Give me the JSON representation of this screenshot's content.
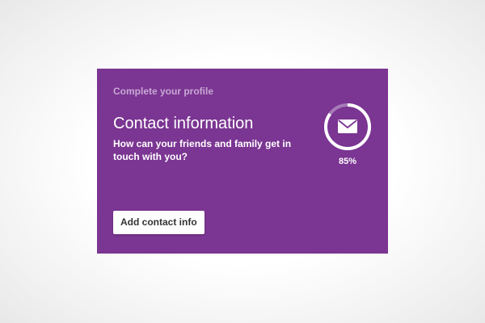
{
  "card": {
    "eyebrow": "Complete your profile",
    "title": "Contact information",
    "subtitle": "How can your friends and family get in touch with you?",
    "action_label": "Add contact info",
    "progress": {
      "value": 0.85,
      "label": "85%",
      "icon": "envelope-icon"
    }
  },
  "colors": {
    "card_background": "#7b3592",
    "eyebrow_text": "#c7a8d3",
    "primary_text": "#ffffff",
    "progress_track": "#a77bb8",
    "progress_fill": "#ffffff",
    "button_background": "#ffffff",
    "button_text": "#333333"
  }
}
